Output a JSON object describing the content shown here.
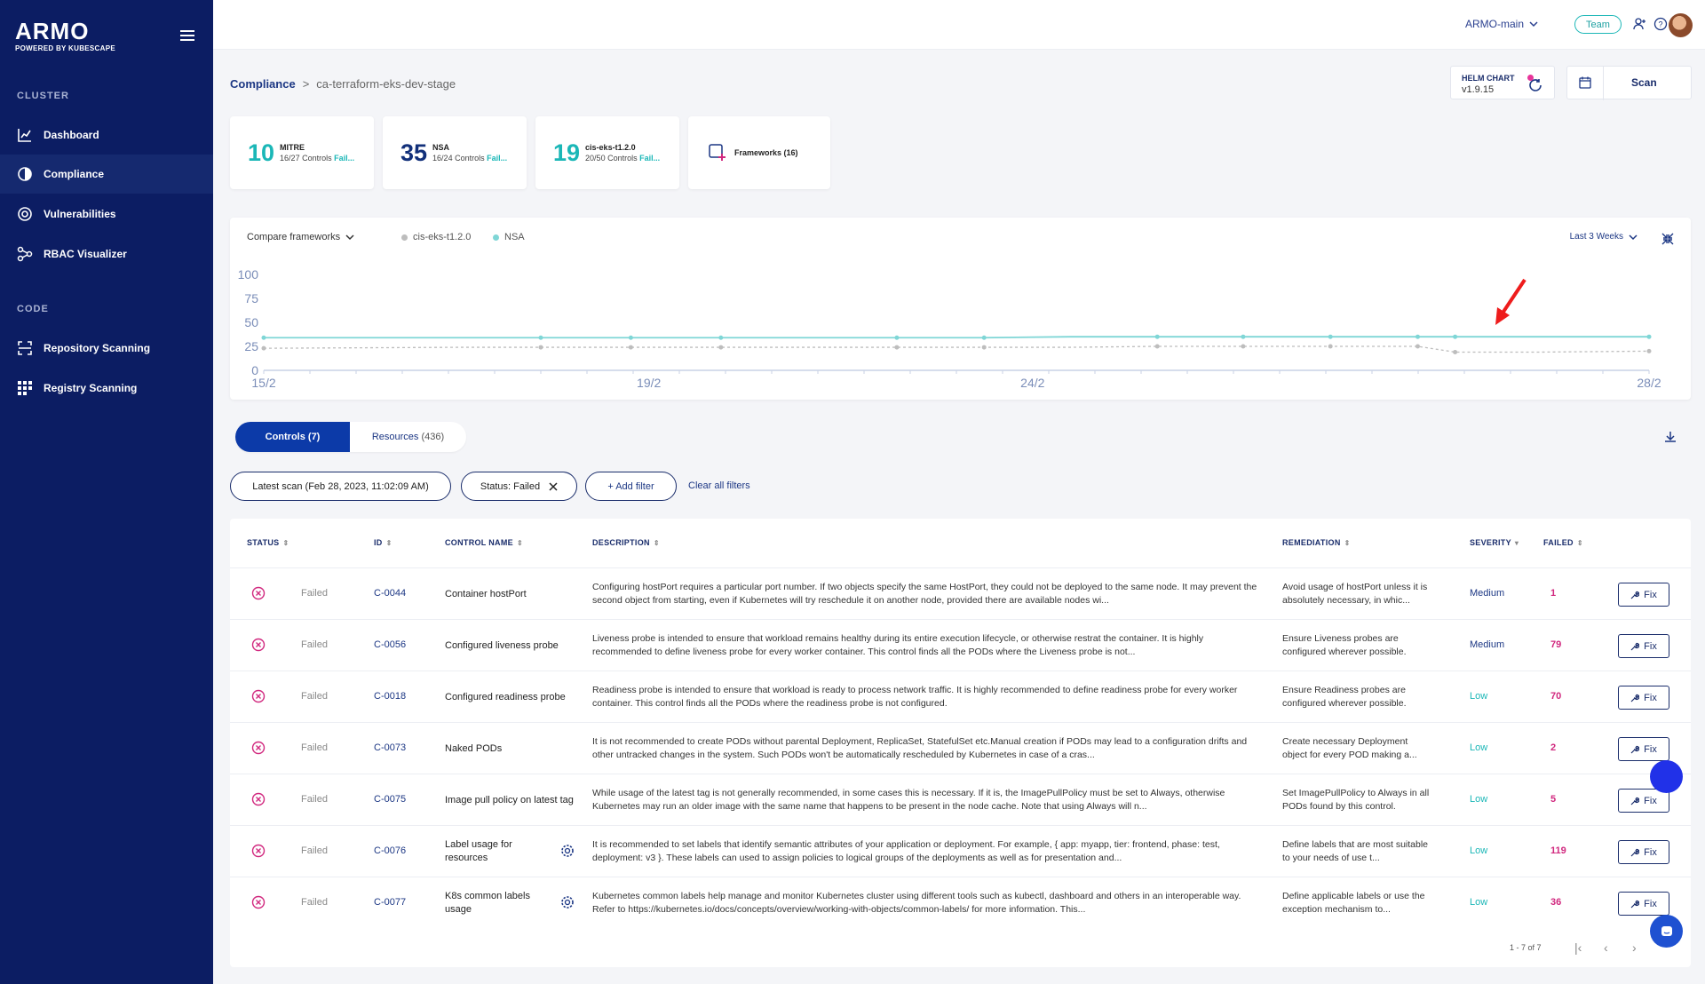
{
  "brand": {
    "name": "ARMO",
    "sub": "POWERED BY KUBESCAPE"
  },
  "sidebar": {
    "sections": [
      "CLUSTER",
      "CODE"
    ],
    "items": [
      {
        "label": "Dashboard",
        "icon": "chart-icon"
      },
      {
        "label": "Compliance",
        "icon": "compliance-icon"
      },
      {
        "label": "Vulnerabilities",
        "icon": "vulnerability-icon"
      },
      {
        "label": "RBAC Visualizer",
        "icon": "rbac-icon"
      },
      {
        "label": "Repository Scanning",
        "icon": "repository-icon"
      },
      {
        "label": "Registry Scanning",
        "icon": "registry-icon"
      }
    ]
  },
  "topbar": {
    "workspace": "ARMO-main",
    "team": "Team"
  },
  "breadcrumb": {
    "root": "Compliance",
    "sep": ">",
    "current": "ca-terraform-eks-dev-stage"
  },
  "helm": {
    "label": "HELM CHART",
    "version": "v1.9.15"
  },
  "scan_label": "Scan",
  "frameworks": [
    {
      "score": "10",
      "name": "MITRE",
      "sub": "16/27 Controls",
      "fail": "Fail..."
    },
    {
      "score": "35",
      "name": "NSA",
      "sub": "16/24 Controls",
      "fail": "Fail..."
    },
    {
      "score": "19",
      "name": "cis-eks-t1.2.0",
      "sub": "20/50 Controls",
      "fail": "Fail..."
    }
  ],
  "frameworks_link": "Frameworks (16)",
  "colors": {
    "teal": "#1bb7b7",
    "navy": "#0c1d63",
    "mitre": "#1bb7b7",
    "nsa": "#12307a",
    "cis": "#1bb7b7",
    "medium": "#1c3784",
    "low": "#1bb7b7",
    "fail": "#d1297f"
  },
  "chart_controls": {
    "compare": "Compare frameworks",
    "range": "Last 3 Weeks"
  },
  "chart_data": {
    "type": "line",
    "ylim": [
      0,
      100
    ],
    "yticks": [
      "100",
      "75",
      "50",
      "25",
      "0"
    ],
    "xticks": [
      "15/2",
      "19/2",
      "24/2",
      "28/2"
    ],
    "series": [
      {
        "name": "cis-eks-t1.2.0",
        "color": "#bdbdbd",
        "values": [
          23,
          24,
          24,
          24,
          24,
          24,
          24,
          24,
          24,
          25,
          25,
          25,
          25,
          19,
          19,
          20
        ]
      },
      {
        "name": "NSA",
        "color": "#7fd6d6",
        "values": [
          34,
          34,
          34,
          34,
          34,
          34,
          34,
          34,
          35,
          35,
          35,
          35,
          35,
          35,
          35,
          35
        ]
      }
    ]
  },
  "tabs": {
    "controls": "Controls (7)",
    "resources": "Resources",
    "resources_count": "(436)"
  },
  "filters": {
    "scan": "Latest scan (Feb 28, 2023, 11:02:09 AM)",
    "status": "Status: Failed",
    "add": "+ Add filter",
    "clear": "Clear all filters"
  },
  "table": {
    "headers": {
      "status": "STATUS",
      "id": "ID",
      "name": "CONTROL NAME",
      "desc": "DESCRIPTION",
      "rem": "REMEDIATION",
      "sev": "SEVERITY",
      "failed": "FAILED"
    },
    "rows": [
      {
        "status": "Failed",
        "id": "C-0044",
        "name": "Container hostPort",
        "desc": "Configuring hostPort requires a particular port number. If two objects specify the same HostPort, they could not be deployed to the same node. It may prevent the second object from starting, even if Kubernetes will try reschedule it on another node, provided there are available nodes wi...",
        "rem": "Avoid usage of hostPort unless it is absolutely necessary, in whic...",
        "sev": "Medium",
        "failed": "1",
        "fix": "Fix",
        "gear": false
      },
      {
        "status": "Failed",
        "id": "C-0056",
        "name": "Configured liveness probe",
        "desc": "Liveness probe is intended to ensure that workload remains healthy during its entire execution lifecycle, or otherwise restrat the container. It is highly recommended to define liveness probe for every worker container. This control finds all the PODs where the Liveness probe is not...",
        "rem": "Ensure Liveness probes are configured wherever possible.",
        "sev": "Medium",
        "failed": "79",
        "fix": "Fix",
        "gear": false
      },
      {
        "status": "Failed",
        "id": "C-0018",
        "name": "Configured readiness probe",
        "desc": "Readiness probe is intended to ensure that workload is ready to process network traffic. It is highly recommended to define readiness probe for every worker container. This control finds all the PODs where the readiness probe is not configured.",
        "rem": "Ensure Readiness probes are configured wherever possible.",
        "sev": "Low",
        "failed": "70",
        "fix": "Fix",
        "gear": false
      },
      {
        "status": "Failed",
        "id": "C-0073",
        "name": "Naked PODs",
        "desc": "It is not recommended to create PODs without parental Deployment, ReplicaSet, StatefulSet etc.Manual creation if PODs may lead to a configuration drifts and other untracked changes in the system. Such PODs won't be automatically rescheduled by Kubernetes in case of a cras...",
        "rem": "Create necessary Deployment object for every POD making a...",
        "sev": "Low",
        "failed": "2",
        "fix": "Fix",
        "gear": false
      },
      {
        "status": "Failed",
        "id": "C-0075",
        "name": "Image pull policy on latest tag",
        "desc": "While usage of the latest tag is not generally recommended, in some cases this is necessary. If it is, the ImagePullPolicy must be set to Always, otherwise Kubernetes may run an older image with the same name that happens to be present in the node cache. Note that using Always will n...",
        "rem": "Set ImagePullPolicy to Always in all PODs found by this control.",
        "sev": "Low",
        "failed": "5",
        "fix": "Fix",
        "gear": false
      },
      {
        "status": "Failed",
        "id": "C-0076",
        "name": "Label usage for resources",
        "desc": "It is recommended to set labels that identify semantic attributes of your application or deployment. For example, { app: myapp, tier: frontend, phase: test, deployment: v3 }. These labels can used to assign policies to logical groups of the deployments as well as for presentation and...",
        "rem": "Define labels that are most suitable to your needs of use t...",
        "sev": "Low",
        "failed": "119",
        "fix": "Fix",
        "gear": true
      },
      {
        "status": "Failed",
        "id": "C-0077",
        "name": "K8s common labels usage",
        "desc": "Kubernetes common labels help manage and monitor Kubernetes cluster using different tools such as kubectl, dashboard and others in an interoperable way. Refer to https://kubernetes.io/docs/concepts/overview/working-with-objects/common-labels/ for more information. This...",
        "rem": "Define applicable labels or use the exception mechanism to...",
        "sev": "Low",
        "failed": "36",
        "fix": "Fix",
        "gear": true
      }
    ]
  },
  "pager": {
    "text": "1 - 7 of 7"
  }
}
